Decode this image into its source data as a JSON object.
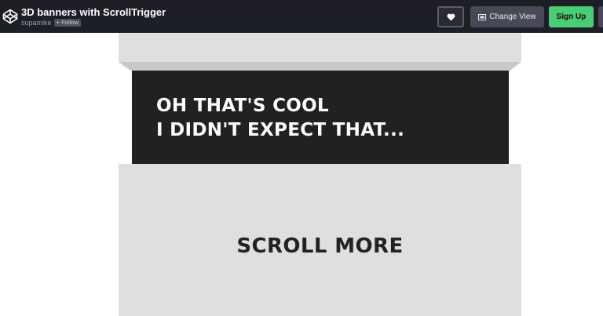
{
  "header": {
    "title": "3D banners with ScrollTrigger",
    "author": "supamike",
    "follow_label": "Follow",
    "follow_icon": "plus-icon",
    "logo_icon": "codepen-logo-icon",
    "heart_icon": "heart-icon",
    "change_view_icon": "layout-icon",
    "change_view_label": "Change View",
    "signup_label": "Sign Up",
    "colors": {
      "bar": "#1e1f26",
      "signup": "#47cf73",
      "button": "#474a56"
    }
  },
  "preview": {
    "banner_line1": "OH THAT'S COOL",
    "banner_line2": "I DIDN'T EXPECT THAT...",
    "scroll_label": "SCROLL MORE",
    "colors": {
      "panel": "#dfdfdf",
      "band": "#212121"
    }
  }
}
